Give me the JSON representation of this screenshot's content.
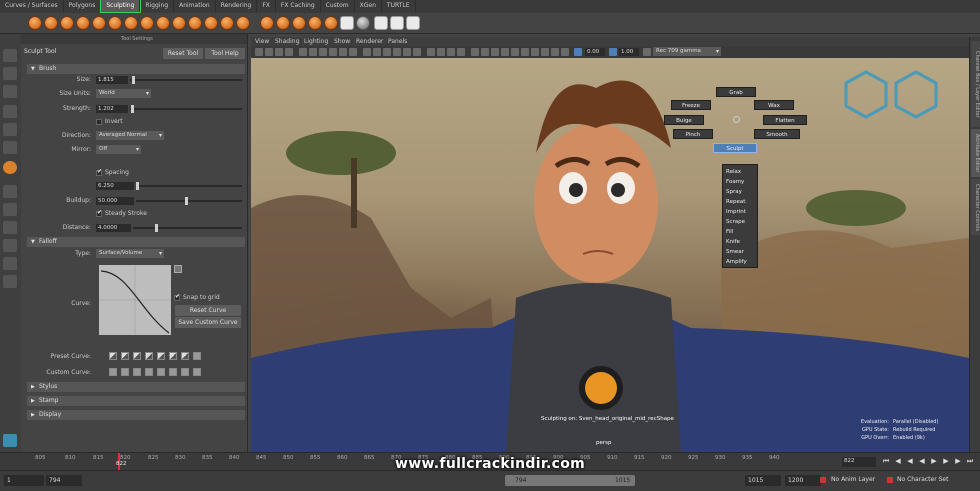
{
  "shelf": {
    "tabs": [
      {
        "label": "Curves / Surfaces",
        "active": false
      },
      {
        "label": "Polygons",
        "active": false
      },
      {
        "label": "Sculpting",
        "active": true
      },
      {
        "label": "Rigging",
        "active": false
      },
      {
        "label": "Animation",
        "active": false
      },
      {
        "label": "Rendering",
        "active": false
      },
      {
        "label": "FX",
        "active": false
      },
      {
        "label": "FX Caching",
        "active": false
      },
      {
        "label": "Custom",
        "active": false
      },
      {
        "label": "XGen",
        "active": false
      },
      {
        "label": "TURTLE",
        "active": false
      }
    ]
  },
  "tool_settings": {
    "panel_title": "Tool Settings",
    "tool_name": "Sculpt Tool",
    "reset_tool": "Reset Tool",
    "tool_help": "Tool Help",
    "brush_section": "Brush",
    "size_label": "Size:",
    "size_value": "1.815",
    "size_units_label": "Size Units:",
    "size_units_value": "World",
    "strength_label": "Strength:",
    "strength_value": "1.202",
    "invert_label": "Invert",
    "direction_label": "Direction:",
    "direction_value": "Averaged Normal",
    "mirror_label": "Mirror:",
    "mirror_value": "Off",
    "spacing_label": "Spacing",
    "spacing_value": "6.250",
    "buildup_label": "Buildup:",
    "buildup_value": "50.000",
    "steady_stroke_label": "Steady Stroke",
    "distance_label": "Distance:",
    "distance_value": "4.0000",
    "falloff_section": "Falloff",
    "type_label": "Type:",
    "type_value": "Surface/Volume",
    "curve_label": "Curve:",
    "snap_to_grid": "Snap to grid",
    "reset_curve": "Reset Curve",
    "save_custom_curve": "Save Custom Curve",
    "preset_curve_label": "Preset Curve:",
    "custom_curve_label": "Custom Curve:",
    "stylus_section": "Stylus",
    "stamp_section": "Stamp",
    "display_section": "Display"
  },
  "viewport": {
    "menu": [
      "View",
      "Shading",
      "Lighting",
      "Show",
      "Renderer",
      "Panels"
    ],
    "field_a": "0.00",
    "field_b": "1.00",
    "color_space": "Rec 709 gamma",
    "sculpting_on": "Sculpting on: Sven_head_original_mid_recShape",
    "hud_small": "persp",
    "hud_right": [
      {
        "label": "Evaluation:",
        "value": "Parallel (Disabled)"
      },
      {
        "label": "GPU State:",
        "value": "Rebuild Required"
      },
      {
        "label": "GPU Overr:",
        "value": "Enabled (9k)"
      }
    ]
  },
  "marking_menu": {
    "top": [
      "Grab",
      "Freeze",
      "Wax",
      "Bulge",
      "Flatten",
      "Pinch",
      "Smooth",
      "Sculpt"
    ],
    "list": [
      "Relax",
      "Foamy",
      "Spray",
      "Repeat",
      "Imprint",
      "Scrape",
      "Fill",
      "Knife",
      "Smear",
      "Amplify"
    ]
  },
  "right_tabs": [
    "Channel Box / Layer Editor",
    "Attribute Editor",
    "Character Controls"
  ],
  "timeline": {
    "ticks": [
      "805",
      "810",
      "815",
      "820",
      "825",
      "830",
      "835",
      "840",
      "845",
      "850",
      "855",
      "860",
      "865",
      "870",
      "875",
      "880",
      "885",
      "890",
      "895",
      "900",
      "905",
      "910",
      "915",
      "920",
      "925",
      "930",
      "935",
      "940"
    ],
    "current_frame": "822"
  },
  "range": {
    "start": "1",
    "start_inner": "794",
    "range_left": "794",
    "range_right": "1015",
    "end_inner": "1015",
    "end": "1200",
    "anim_layer": "No Anim Layer",
    "char_set": "No Character Set"
  },
  "watermark": "www.fullcrackindir.com"
}
